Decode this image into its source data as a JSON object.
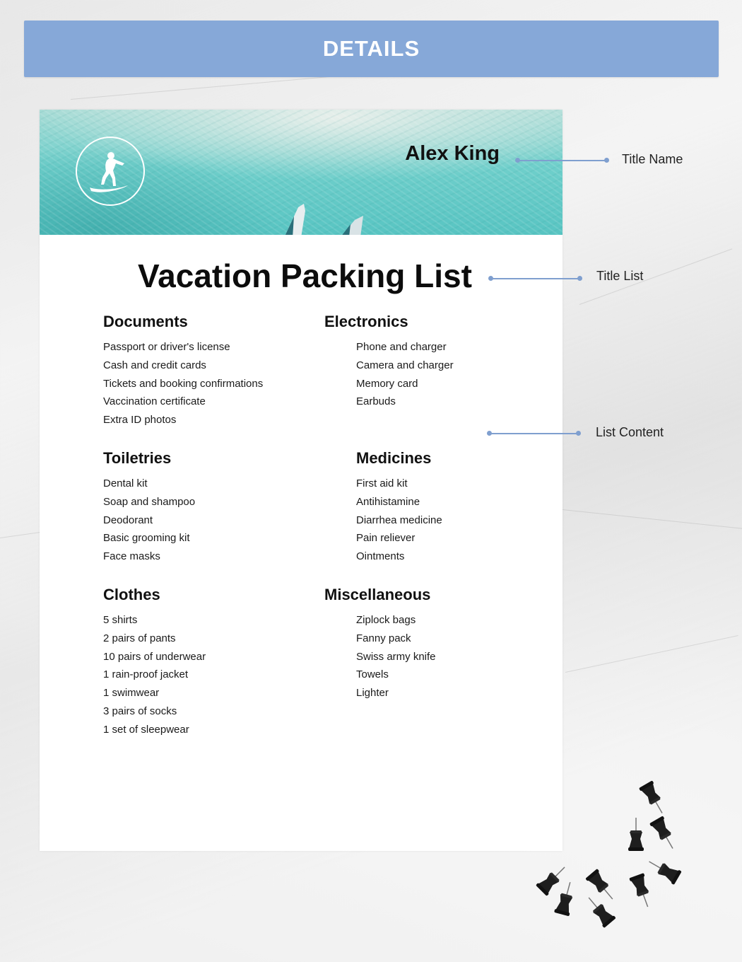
{
  "header": {
    "title": "DETAILS"
  },
  "document": {
    "banner": {
      "name": "Alex King",
      "logo_icon": "surfer-icon"
    },
    "title": "Vacation Packing List",
    "sections": [
      {
        "heading": "Documents",
        "items": [
          "Passport or driver's license",
          "Cash and credit cards",
          "Tickets and booking confirmations",
          "Vaccination certificate",
          "Extra ID photos"
        ]
      },
      {
        "heading": "Electronics",
        "items": [
          "Phone and charger",
          "Camera and charger",
          "Memory card",
          "Earbuds"
        ]
      },
      {
        "heading": "Toiletries",
        "items": [
          "Dental kit",
          "Soap and shampoo",
          "Deodorant",
          "Basic grooming kit",
          "Face masks"
        ]
      },
      {
        "heading": "Medicines",
        "items": [
          "First aid kit",
          "Antihistamine",
          "Diarrhea medicine",
          "Pain reliever",
          "Ointments"
        ]
      },
      {
        "heading": "Clothes",
        "items": [
          "5 shirts",
          "2 pairs of pants",
          "10 pairs of underwear",
          "1 rain-proof jacket",
          "1 swimwear",
          "3 pairs of socks",
          "1 set of sleepwear"
        ]
      },
      {
        "heading": "Miscellaneous",
        "items": [
          "Ziplock bags",
          "Fanny pack",
          "Swiss army knife",
          "Towels",
          "Lighter"
        ]
      }
    ]
  },
  "callouts": [
    {
      "label": "Title Name"
    },
    {
      "label": "Title List"
    },
    {
      "label": "List Content"
    }
  ],
  "colors": {
    "header_bar": "#86a8d8",
    "callout_line": "#7f9fcf",
    "banner_water": "#6fcfcb"
  }
}
